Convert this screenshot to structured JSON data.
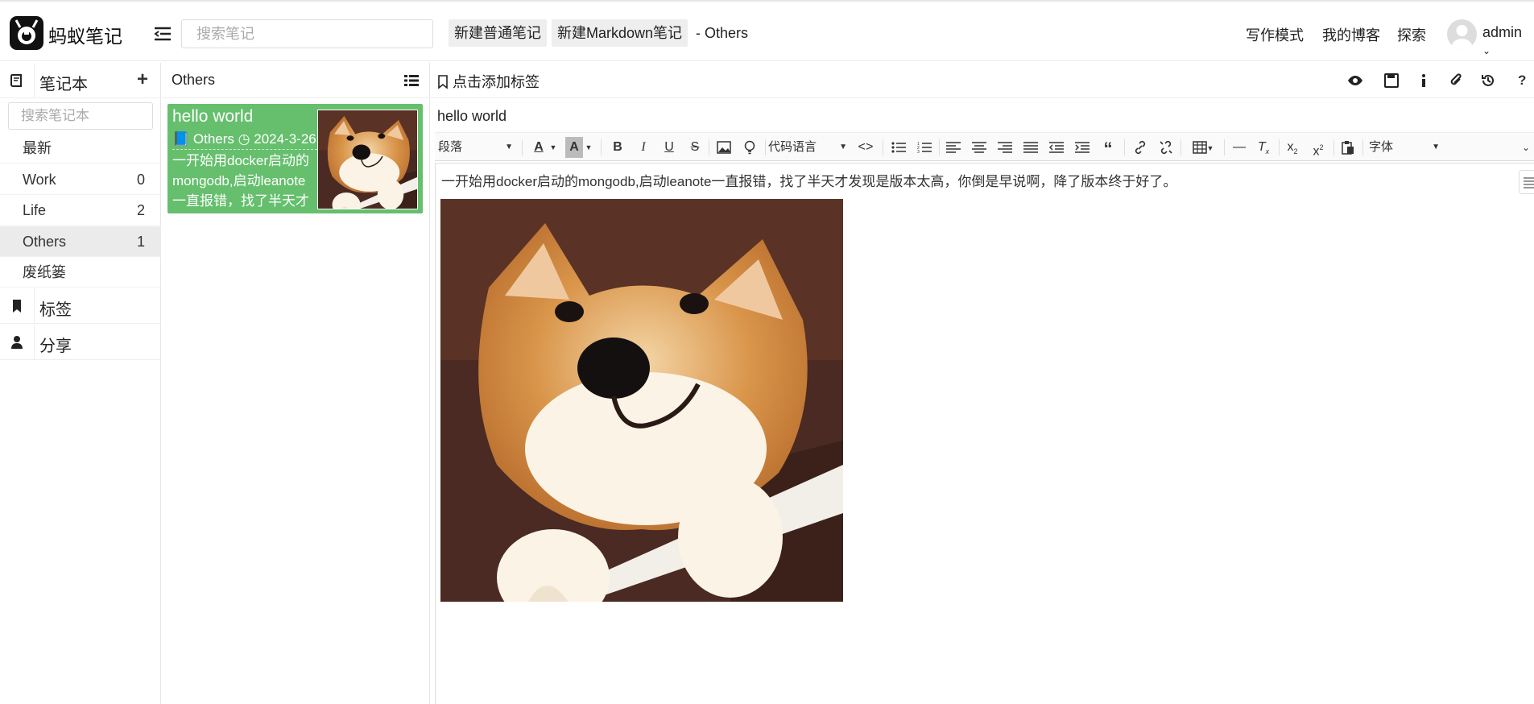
{
  "app": {
    "brand": "蚂蚁笔记"
  },
  "header": {
    "search_placeholder": "搜索笔记",
    "new_normal_note": "新建普通笔记",
    "new_markdown_note": "新建Markdown笔记",
    "breadcrumb": "- Others",
    "links": {
      "write_mode": "写作模式",
      "my_blog": "我的博客",
      "explore": "探索"
    },
    "user": "admin"
  },
  "sidebar": {
    "notebooks_label": "笔记本",
    "notebook_search_placeholder": "搜索笔记本",
    "items": [
      {
        "label": "最新",
        "count": ""
      },
      {
        "label": "Work",
        "count": "0"
      },
      {
        "label": "Life",
        "count": "2"
      },
      {
        "label": "Others",
        "count": "1"
      },
      {
        "label": "废纸篓",
        "count": ""
      }
    ],
    "tags_label": "标签",
    "share_label": "分享"
  },
  "notelist": {
    "title": "Others",
    "notes": [
      {
        "title": "hello world",
        "notebook": "Others",
        "date": "2024-3-26",
        "desc": "一开始用docker启动的mongodb,启动leanote一直报错，找了半天才"
      }
    ]
  },
  "editor": {
    "tag_placeholder": "点击添加标签",
    "note_title": "hello world",
    "toolbar": {
      "paragraph_select": "段落",
      "code_lang_select": "代码语言",
      "font_select": "字体"
    },
    "content_text": "一开始用docker启动的mongodb,启动leanote一直报错，找了半天才发现是版本太高，你倒是早说啊，降了版本终于好了。"
  },
  "colors": {
    "active_note": "#65bf6d",
    "logo_bg": "#111111"
  },
  "icons": [
    "hamburger-icon",
    "book-icon",
    "plus-icon",
    "bookmark-icon",
    "user-icon",
    "list-icon",
    "eye-icon",
    "save-icon",
    "info-icon",
    "attachment-icon",
    "history-icon",
    "help-icon",
    "shiba-dog-image"
  ]
}
